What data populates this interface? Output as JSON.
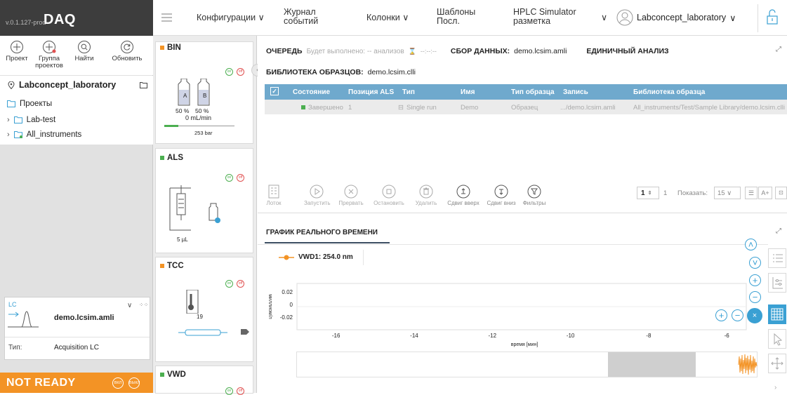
{
  "app": {
    "version": "v.0.1.127-prod",
    "name": "DAQ"
  },
  "actions": [
    {
      "label": "Проект",
      "icon": "plus-circle-icon"
    },
    {
      "label": "Группа проектов",
      "icon": "plus-circle-icon"
    },
    {
      "label": "Найти",
      "icon": "search-circle-icon"
    },
    {
      "label": "Обновить",
      "icon": "refresh-circle-icon"
    }
  ],
  "project": {
    "title": "Labconcept_laboratory"
  },
  "tree": {
    "header": "Проекты",
    "items": [
      {
        "label": "Lab-test"
      },
      {
        "label": "All_instruments"
      }
    ]
  },
  "lc": {
    "badge": "LC",
    "method": "demo.lcsim.amli",
    "type_label": "Тип:",
    "type_value": "Acquisition LC"
  },
  "status": {
    "text": "NOT READY",
    "on": "ВКЛ",
    "off": "ВЫКЛ"
  },
  "modules": {
    "bin": {
      "title": "BIN",
      "on": "on",
      "off": "off",
      "bottle_a": "A",
      "bottle_b": "B",
      "pct_a": "50 %",
      "pct_b": "50 %",
      "flow": "0 mL/min",
      "pressure": "253 bar",
      "pressure_fraction": 0.2
    },
    "als": {
      "title": "ALS",
      "on": "on",
      "off": "off",
      "volume": "5 µL"
    },
    "tcc": {
      "title": "TCC",
      "on": "on",
      "off": "off",
      "temp": "19"
    },
    "vwd": {
      "title": "VWD",
      "on": "on",
      "off": "off"
    }
  },
  "nav": {
    "config": "Конфигурации",
    "journal": "Журнал событий",
    "columns": "Колонки",
    "templates": "Шаблоны Посл.",
    "hplc": "HPLC Simulator разметка",
    "user": "Labconcept_laboratory"
  },
  "queue": {
    "title": "ОЧЕРЕДЬ",
    "pending": "Будет выполнено: -- анализов",
    "timer": "--:--:--",
    "collect_label": "СБОР ДАННЫХ:",
    "collect_value": "demo.lcsim.amli",
    "single": "ЕДИНИЧНЫЙ АНАЛИЗ",
    "library_label": "БИБЛИОТЕКА ОБРАЗЦОВ:",
    "library_value": "demo.lcsim.clli",
    "columns": [
      "Состояние",
      "Позиция ALS",
      "Тип",
      "Имя",
      "Тип образца",
      "Запись",
      "Библиотека образца"
    ],
    "rows": [
      {
        "state": "Завершено",
        "pos": "1",
        "type": "Single run",
        "name": "Demo",
        "sample_type": "Образец",
        "record": ".../demo.lcsim.amli",
        "library": "All_instruments/Test/Sample Library/demo.lcsim.clli"
      }
    ],
    "toolbar": [
      "Лоток",
      "Запустить",
      "Прервать",
      "Остановить",
      "Удалить",
      "Сдвиг вверх",
      "Сдвиг вниз",
      "Фильтры"
    ],
    "page": "1",
    "page_total": "1",
    "show_label": "Показать:",
    "show_value": "15",
    "font_btn": "A+"
  },
  "realtime": {
    "tab": "ГРАФИК РЕАЛЬНОГО ВРЕМЕНИ"
  },
  "chart_data": {
    "type": "line",
    "series": [
      {
        "name": "VWD1: 254.0 nm",
        "color": "#f39325",
        "values": []
      }
    ],
    "xlabel": "время [мин]",
    "ylabel": "миллиом/л",
    "x_ticks": [
      "-16",
      "-14",
      "-12",
      "-10",
      "-8",
      "-6"
    ],
    "y_ticks": [
      "0.02",
      "0",
      "-0.02"
    ],
    "xlim": [
      -17,
      -5.5
    ],
    "ylim": [
      -0.03,
      0.03
    ]
  },
  "colors": {
    "accent": "#3aa0d3",
    "ok": "#4caf50",
    "warn": "#f39325",
    "off": "#e05050"
  }
}
